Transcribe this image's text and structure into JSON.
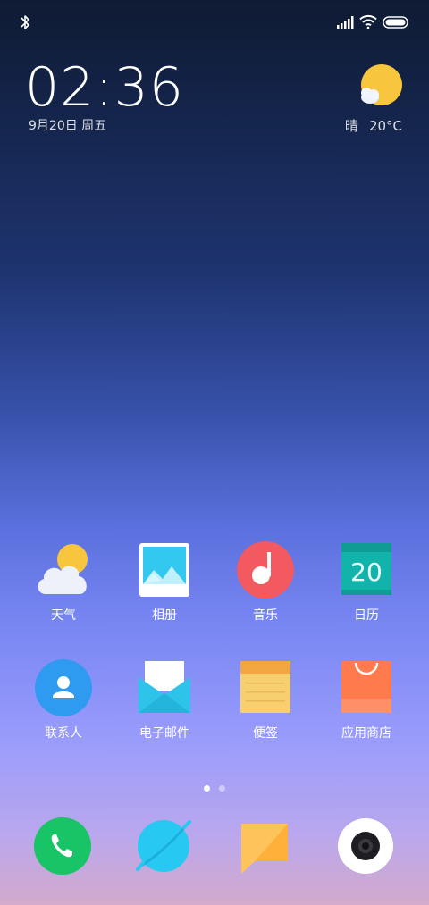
{
  "status_bar": {
    "bluetooth_icon": "bluetooth-icon",
    "signal_icon": "signal-icon",
    "wifi_icon": "wifi-icon",
    "battery_icon": "battery-icon"
  },
  "clock_widget": {
    "time": "02:36",
    "date": "9月20日 周五"
  },
  "weather_widget": {
    "condition": "晴",
    "temperature": "20°C",
    "icon": "sun-cloud-icon"
  },
  "apps_row1": [
    {
      "label": "天气",
      "icon": "weather-icon"
    },
    {
      "label": "相册",
      "icon": "gallery-icon"
    },
    {
      "label": "音乐",
      "icon": "music-icon"
    },
    {
      "label": "日历",
      "icon": "calendar-icon",
      "icon_text": "20"
    }
  ],
  "apps_row2": [
    {
      "label": "联系人",
      "icon": "contacts-icon"
    },
    {
      "label": "电子邮件",
      "icon": "email-icon"
    },
    {
      "label": "便签",
      "icon": "notes-icon"
    },
    {
      "label": "应用商店",
      "icon": "app-store-icon"
    }
  ],
  "page_indicator": {
    "pages": 2,
    "current": 1
  },
  "dock": [
    {
      "icon": "phone-icon"
    },
    {
      "icon": "browser-icon"
    },
    {
      "icon": "messages-icon"
    },
    {
      "icon": "camera-icon"
    }
  ],
  "colors": {
    "music": "#f25a5f",
    "calendar": "#12b3ab",
    "contacts": "#2f9bf0",
    "email": "#2ec3e8",
    "notes": "#f7cf6e",
    "app_store": "#ff7a4d",
    "phone": "#18c466",
    "browser": "#27c9f3",
    "messages": "#ffc35c"
  }
}
